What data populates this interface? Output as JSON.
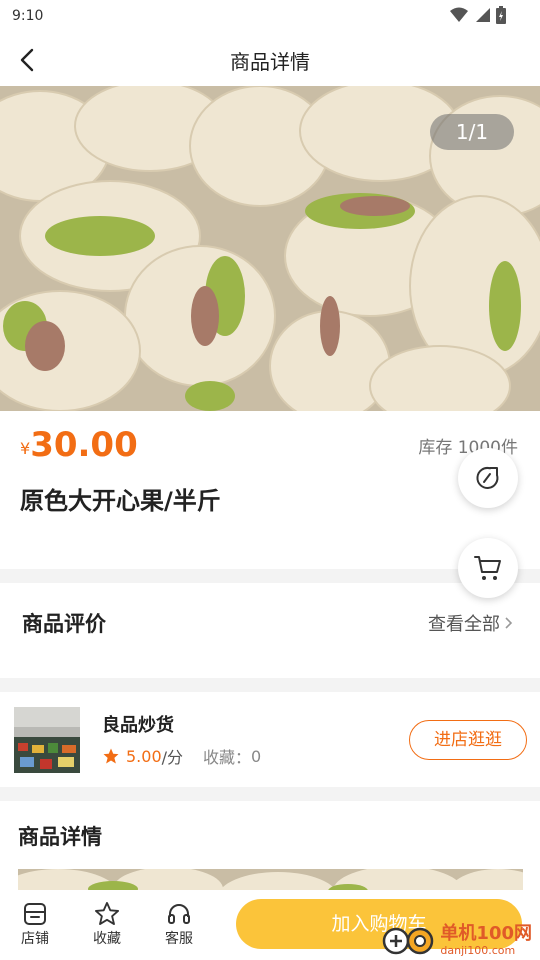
{
  "status_bar": {
    "time": "9:10"
  },
  "nav": {
    "title": "商品详情"
  },
  "gallery": {
    "pager": "1/1",
    "image_subject": "pistachios-photo"
  },
  "product": {
    "currency_symbol": "¥",
    "price": "30.00",
    "stock": "库存 1000件",
    "name": "原色大开心果/半斤"
  },
  "reviews": {
    "title": "商品评价",
    "view_all": "查看全部"
  },
  "shop": {
    "name": "良品炒货",
    "rating": "5.00",
    "rating_unit": "/分",
    "favorites_label": "收藏：",
    "favorites_count": "0",
    "visit_button": "进店逛逛"
  },
  "detail": {
    "title": "商品详情"
  },
  "bottom_bar": {
    "tabs": [
      {
        "label": "店铺",
        "icon": "store-icon"
      },
      {
        "label": "收藏",
        "icon": "star-outline-icon"
      },
      {
        "label": "客服",
        "icon": "headset-icon"
      }
    ],
    "add_to_cart": "加入购物车"
  },
  "watermark": {
    "text_cn": "单机100网",
    "text_en": "danji100.com"
  },
  "colors": {
    "accent": "#f26d14",
    "cart_button": "#fbc43a",
    "page_bg": "#f3f3f3"
  }
}
